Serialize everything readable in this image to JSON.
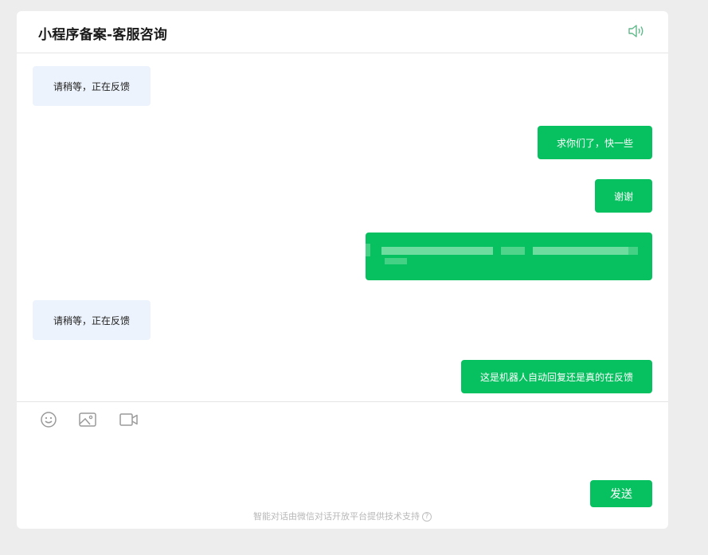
{
  "header": {
    "title": "小程序备案-客服咨询",
    "speaker_icon": "speaker-icon"
  },
  "messages": [
    {
      "side": "in",
      "text": "请稍等，正在反馈"
    },
    {
      "side": "out",
      "text": "求你们了，快一些"
    },
    {
      "side": "out",
      "text": "谢谢"
    },
    {
      "side": "out",
      "text": "",
      "redacted": true
    },
    {
      "side": "in",
      "text": "请稍等，正在反馈"
    },
    {
      "side": "out",
      "text": "这是机器人自动回复还是真的在反馈"
    }
  ],
  "composer": {
    "tools": [
      "emoji-icon",
      "image-icon",
      "video-icon"
    ],
    "send_label": "发送"
  },
  "footer": {
    "text": "智能对话由微信对话开放平台提供技术支持",
    "help_icon": "help-icon"
  },
  "colors": {
    "accent": "#07c160",
    "incoming_bubble": "#edf3fc",
    "page_bg": "#ededed"
  }
}
